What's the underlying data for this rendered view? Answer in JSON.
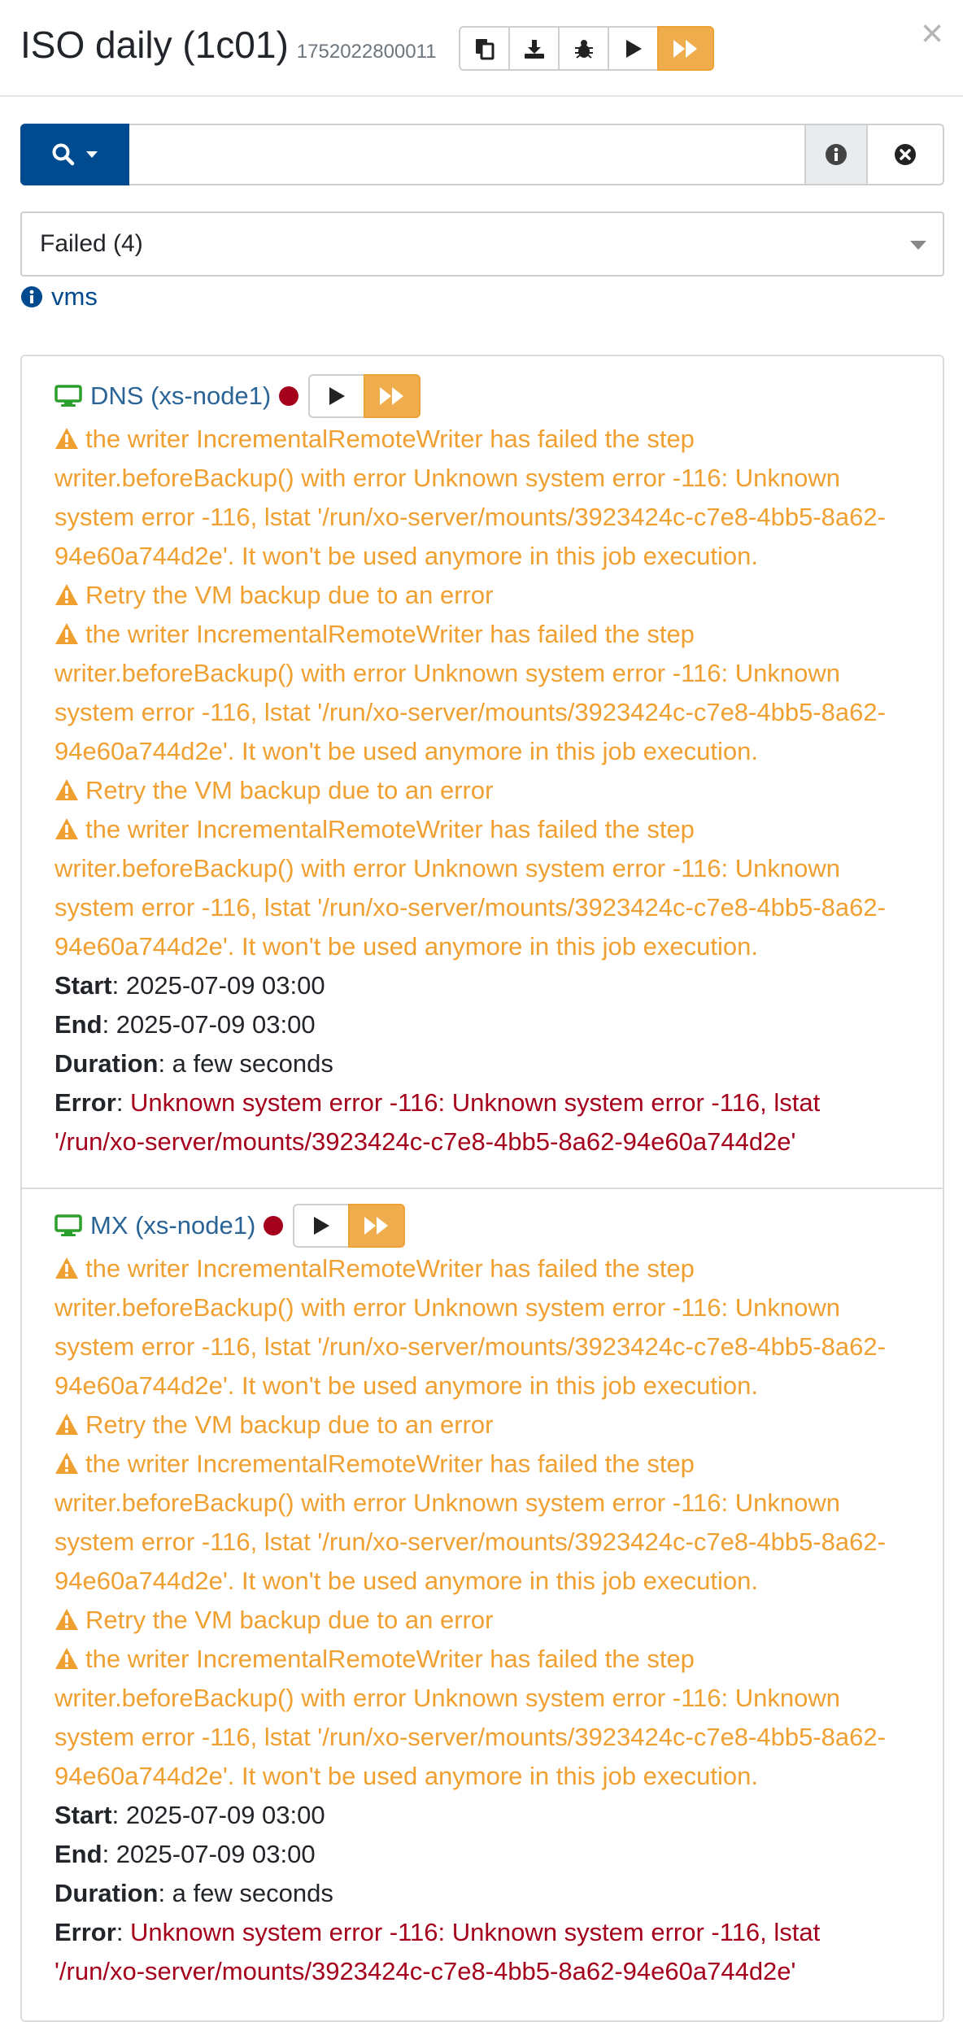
{
  "header": {
    "title": "ISO daily (1c01)",
    "job_id": "1752022800011",
    "toolbar_icons": [
      "copy-icon",
      "download-icon",
      "bug-icon",
      "play-icon",
      "fast-forward-icon"
    ]
  },
  "search": {
    "value": "",
    "placeholder": ""
  },
  "filter": {
    "selected": "Failed (4)"
  },
  "vms_link": "vms",
  "labels": {
    "start": "Start",
    "end": "End",
    "duration": "Duration",
    "error": "Error"
  },
  "vms": [
    {
      "name": "DNS (xs-node1)",
      "messages": [
        {
          "kind": "warning",
          "text": "the writer IncrementalRemoteWriter has failed the step writer.beforeBackup() with error Unknown system error -116: Unknown system error -116, lstat '/run/xo-server/mounts/3923424c-c7e8-4bb5-8a62-94e60a744d2e'. It won't be used anymore in this job execution."
        },
        {
          "kind": "warning",
          "text": "Retry the VM backup due to an error"
        },
        {
          "kind": "warning",
          "text": "the writer IncrementalRemoteWriter has failed the step writer.beforeBackup() with error Unknown system error -116: Unknown system error -116, lstat '/run/xo-server/mounts/3923424c-c7e8-4bb5-8a62-94e60a744d2e'. It won't be used anymore in this job execution."
        },
        {
          "kind": "warning",
          "text": "Retry the VM backup due to an error"
        },
        {
          "kind": "warning",
          "text": "the writer IncrementalRemoteWriter has failed the step writer.beforeBackup() with error Unknown system error -116: Unknown system error -116, lstat '/run/xo-server/mounts/3923424c-c7e8-4bb5-8a62-94e60a744d2e'. It won't be used anymore in this job execution."
        }
      ],
      "start": "2025-07-09 03:00",
      "end": "2025-07-09 03:00",
      "duration": "a few seconds",
      "error": "Unknown system error -116: Unknown system error -116, lstat '/run/xo-server/mounts/3923424c-c7e8-4bb5-8a62-94e60a744d2e'"
    },
    {
      "name": "MX (xs-node1)",
      "messages": [
        {
          "kind": "warning",
          "text": "the writer IncrementalRemoteWriter has failed the step writer.beforeBackup() with error Unknown system error -116: Unknown system error -116, lstat '/run/xo-server/mounts/3923424c-c7e8-4bb5-8a62-94e60a744d2e'. It won't be used anymore in this job execution."
        },
        {
          "kind": "warning",
          "text": "Retry the VM backup due to an error"
        },
        {
          "kind": "warning",
          "text": "the writer IncrementalRemoteWriter has failed the step writer.beforeBackup() with error Unknown system error -116: Unknown system error -116, lstat '/run/xo-server/mounts/3923424c-c7e8-4bb5-8a62-94e60a744d2e'. It won't be used anymore in this job execution."
        },
        {
          "kind": "warning",
          "text": "Retry the VM backup due to an error"
        },
        {
          "kind": "warning",
          "text": "the writer IncrementalRemoteWriter has failed the step writer.beforeBackup() with error Unknown system error -116: Unknown system error -116, lstat '/run/xo-server/mounts/3923424c-c7e8-4bb5-8a62-94e60a744d2e'. It won't be used anymore in this job execution."
        }
      ],
      "start": "2025-07-09 03:00",
      "end": "2025-07-09 03:00",
      "duration": "a few seconds",
      "error": "Unknown system error -116: Unknown system error -116, lstat '/run/xo-server/mounts/3923424c-c7e8-4bb5-8a62-94e60a744d2e'"
    }
  ],
  "colors": {
    "primary": "#004a8f",
    "link": "#2a6496",
    "warning": "#f0a030",
    "danger": "#a5001c",
    "accent_button": "#f0ad4e",
    "vm_icon": "#2ca02c"
  }
}
